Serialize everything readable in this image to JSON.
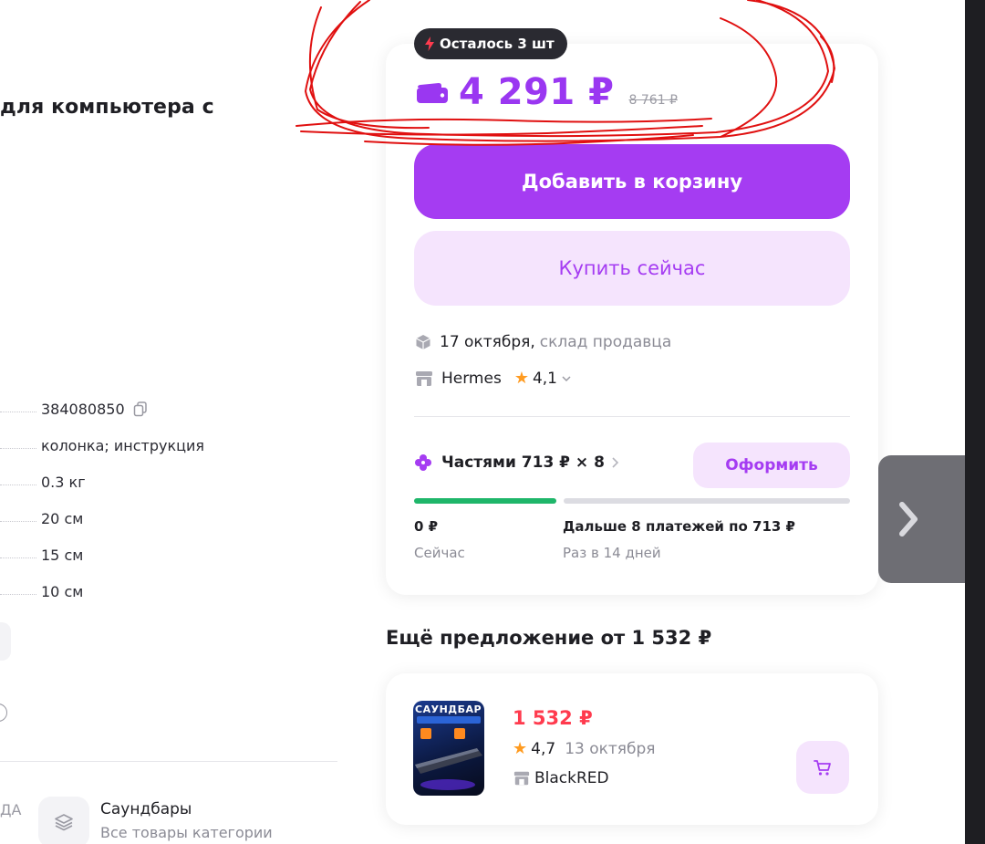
{
  "product": {
    "title_fragment": "для компьютера с"
  },
  "specs": [
    {
      "value": "384080850",
      "copyable": true
    },
    {
      "value": "колонка; инструкция"
    },
    {
      "value": "0.3 кг"
    },
    {
      "value": "20 см"
    },
    {
      "value": "15 см"
    },
    {
      "value": "10 см"
    }
  ],
  "left_bottom": {
    "cut_text": "ДА",
    "category_title": "Саундбары",
    "category_subtitle": "Все товары категории"
  },
  "buy_card": {
    "stock_badge": "Осталось 3 шт",
    "price": "4 291 ₽",
    "old_price": "8 761 ₽",
    "add_to_cart": "Добавить в корзину",
    "buy_now": "Купить сейчас",
    "delivery_date": "17 октября,",
    "delivery_source": "склад продавца",
    "seller_name": "Hermes",
    "seller_rating": "4,1",
    "installments_label": "Частями 713 ₽ × 8",
    "checkout_label": "Оформить",
    "pay_now_amount": "0 ₽",
    "pay_now_label": "Сейчас",
    "pay_later_amount": "Дальше 8 платежей по 713 ₽",
    "pay_later_label": "Раз в 14 дней"
  },
  "other_offers": {
    "heading": "Ещё предложение от 1 532 ₽",
    "offer": {
      "thumb_title": "САУНДБАР",
      "price": "1 532 ₽",
      "rating": "4,7",
      "delivery_date": "13 октября",
      "seller": "BlackRED"
    }
  },
  "colors": {
    "accent": "#a53cf2",
    "accent_light": "#f5e4fd",
    "price": "#9a37f1",
    "offer_price": "#ff3b4e",
    "star": "#ff9b20",
    "progress_now": "#1fb66a",
    "annotation": "#e01010"
  },
  "icons": {
    "badge": "lightning-icon",
    "price": "wallet-icon",
    "delivery": "box-icon",
    "seller": "shop-icon",
    "installments": "clover-icon",
    "cart": "cart-icon",
    "gallery_next": "chevron-right-icon"
  }
}
